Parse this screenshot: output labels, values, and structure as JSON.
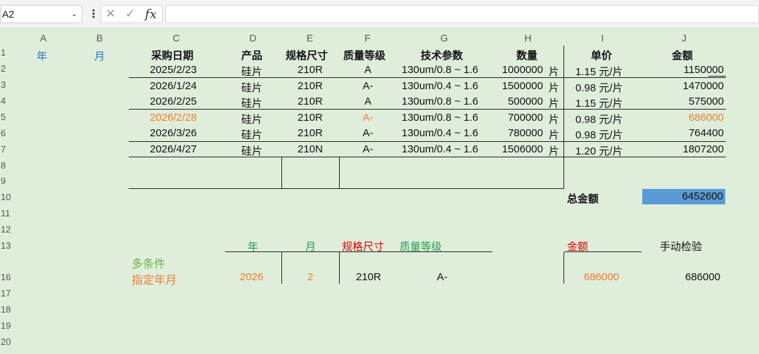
{
  "namebox": {
    "value": "A2"
  },
  "formula": {
    "fx_label": "fx",
    "cancel_icon": "✕",
    "confirm_icon": "✓",
    "value": ""
  },
  "columns": [
    "A",
    "B",
    "C",
    "D",
    "E",
    "F",
    "G",
    "H",
    "I",
    "J"
  ],
  "rows": [
    "1",
    "2",
    "3",
    "4",
    "5",
    "6",
    "7",
    "8",
    "9",
    "10",
    "11",
    "12",
    "13",
    "16",
    "17",
    "18",
    "19",
    "20"
  ],
  "header_row": {
    "year": "年",
    "month": "月",
    "date": "采购日期",
    "product": "产品",
    "spec": "规格尺寸",
    "grade": "质量等级",
    "tech": "技术参数",
    "qty": "数量",
    "price": "单价",
    "amount": "金额"
  },
  "records": [
    {
      "date": "2025/2/23",
      "product": "硅片",
      "spec": "210R",
      "grade": "A",
      "tech": "130um/0.8 ~ 1.6",
      "qty": "1000000",
      "unit": "片",
      "price": "1.15 元/片",
      "amount": "1150000",
      "highlight": false
    },
    {
      "date": "2026/1/24",
      "product": "硅片",
      "spec": "210R",
      "grade": "A-",
      "tech": "130um/0.4 ~ 1.6",
      "qty": "1500000",
      "unit": "片",
      "price": "0.98 元/片",
      "amount": "1470000",
      "highlight": false
    },
    {
      "date": "2026/2/25",
      "product": "硅片",
      "spec": "210R",
      "grade": "A",
      "tech": "130um/0.8 ~ 1.6",
      "qty": "500000",
      "unit": "片",
      "price": "1.15 元/片",
      "amount": "575000",
      "highlight": false
    },
    {
      "date": "2026/2/28",
      "product": "硅片",
      "spec": "210R",
      "grade": "A-",
      "tech": "130um/0.8 ~ 1.6",
      "qty": "700000",
      "unit": "片",
      "price": "0.98 元/片",
      "amount": "686000",
      "highlight": true
    },
    {
      "date": "2026/3/26",
      "product": "硅片",
      "spec": "210R",
      "grade": "A-",
      "tech": "130um/0.4 ~ 1.6",
      "qty": "780000",
      "unit": "片",
      "price": "0.98 元/片",
      "amount": "764400",
      "highlight": false
    },
    {
      "date": "2026/4/27",
      "product": "硅片",
      "spec": "210N",
      "grade": "A-",
      "tech": "130um/0.4 ~ 1.6",
      "qty": "1506000",
      "unit": "片",
      "price": "1.20 元/片",
      "amount": "1807200",
      "highlight": false
    }
  ],
  "total": {
    "label": "总金额",
    "value": "6452600",
    "fill": "#5b9bd5"
  },
  "query": {
    "header": {
      "year": "年",
      "month": "月",
      "spec": "规格尺寸",
      "grade": "质量等级",
      "amount": "金额",
      "manual": "手动检验"
    },
    "title_line1": "多条件",
    "title_line2": "指定年月",
    "year": "2026",
    "month": "2",
    "spec": "210R",
    "grade": "A-",
    "amount": "686000",
    "manual": "686000"
  },
  "colors": {
    "background": "#dfeedb",
    "orange": "#ed7d31",
    "red": "#e00000",
    "green": "#22a050",
    "blue": "#2e75b6"
  }
}
